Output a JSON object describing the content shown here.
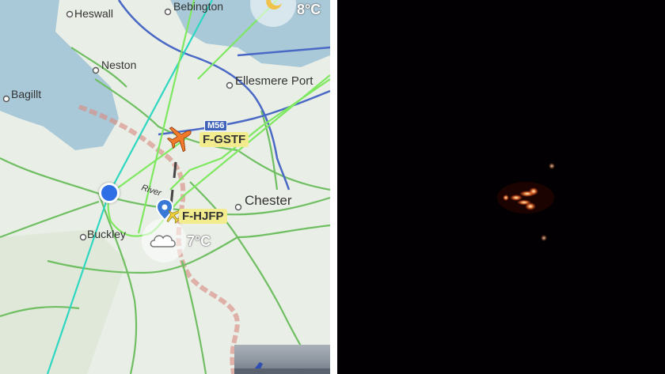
{
  "map": {
    "places": {
      "heswall": "Heswall",
      "bebington": "Bebington",
      "neston": "Neston",
      "ellesmere_port": "Ellesmere Port",
      "bagillt": "Bagillt",
      "chester": "Chester",
      "buckley": "Buckley",
      "river": "River"
    },
    "motorway": "M56",
    "weather": [
      {
        "temp": "8°C",
        "icon": "moon-cloud-icon"
      },
      {
        "temp": "7°C",
        "icon": "cloud-icon"
      }
    ],
    "flights": [
      {
        "callsign": "F-GSTF",
        "icon": "airplane-icon",
        "color": "#f07a2a"
      },
      {
        "callsign": "F-HJFP",
        "icon": "airplane-icon",
        "color": "#f2d23b"
      }
    ],
    "colors": {
      "water": "#a9c9d8",
      "land": "#e9eee6",
      "road": "#6fbf62",
      "motorway": "#4a68c5",
      "track": "#7ee860",
      "track_alt": "#2ed7c1",
      "border": "#d98f85"
    }
  },
  "photo": {
    "description_icon": "night-sky-lights"
  }
}
